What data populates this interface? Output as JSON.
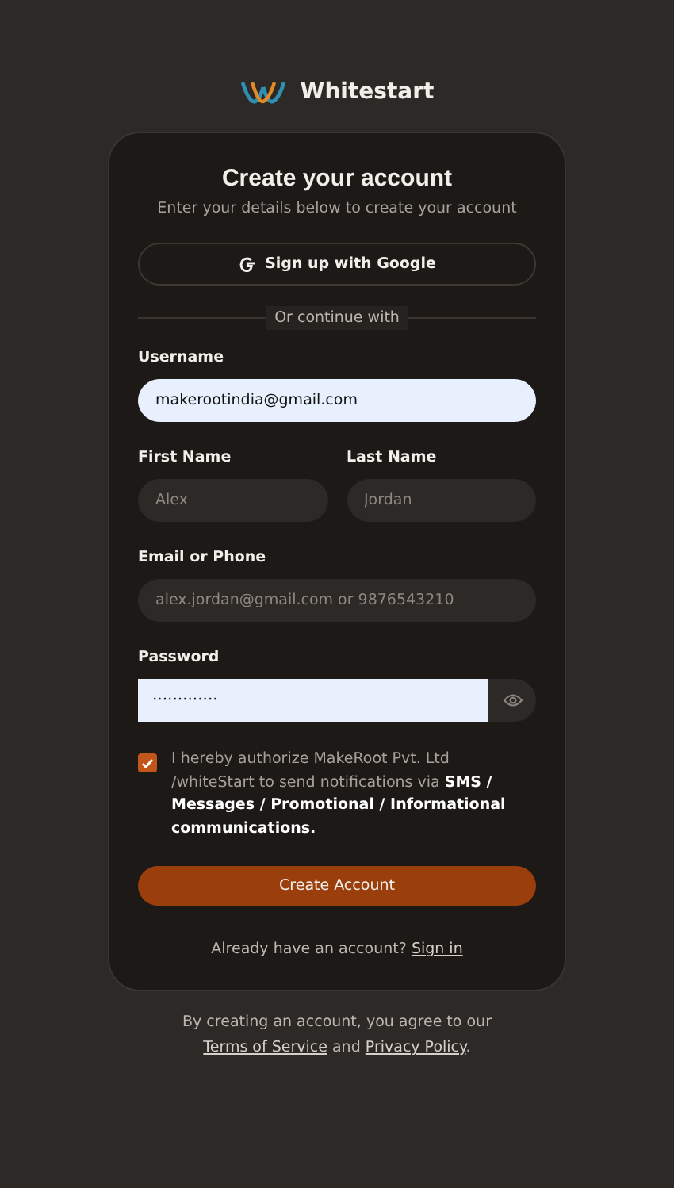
{
  "brand": {
    "name": "Whitestart"
  },
  "card": {
    "title": "Create your account",
    "subtitle": "Enter your details below to create your account"
  },
  "google_button": {
    "label": "Sign up with Google"
  },
  "divider": {
    "label": "Or continue with"
  },
  "fields": [
    {
      "kind": "full",
      "label": "Username",
      "value": "makerootindia@gmail.com",
      "filled": true
    },
    {
      "kind": "pair",
      "items": [
        {
          "label": "First Name",
          "placeholder": "Alex"
        },
        {
          "label": "Last Name",
          "placeholder": "Jordan"
        }
      ]
    },
    {
      "kind": "full",
      "label": "Email or Phone",
      "placeholder": "alex.jordan@gmail.com or 9876543210",
      "filled": false
    },
    {
      "kind": "password",
      "label": "Password",
      "value": "·············",
      "filled": true
    }
  ],
  "consent": {
    "checked": true,
    "text": "I hereby authorize MakeRoot Pvt. Ltd /whiteStart to send notifications via **SMS / Messages / Promotional / Informational communications.**"
  },
  "submit": {
    "label": "Create Account"
  },
  "signin": {
    "text": "Already have an account?",
    "link": "Sign in"
  },
  "footer": {
    "text": "By creating an account, you agree to our",
    "terms": "Terms of Service",
    "and": "and",
    "privacy": "Privacy Policy",
    "end": "."
  }
}
